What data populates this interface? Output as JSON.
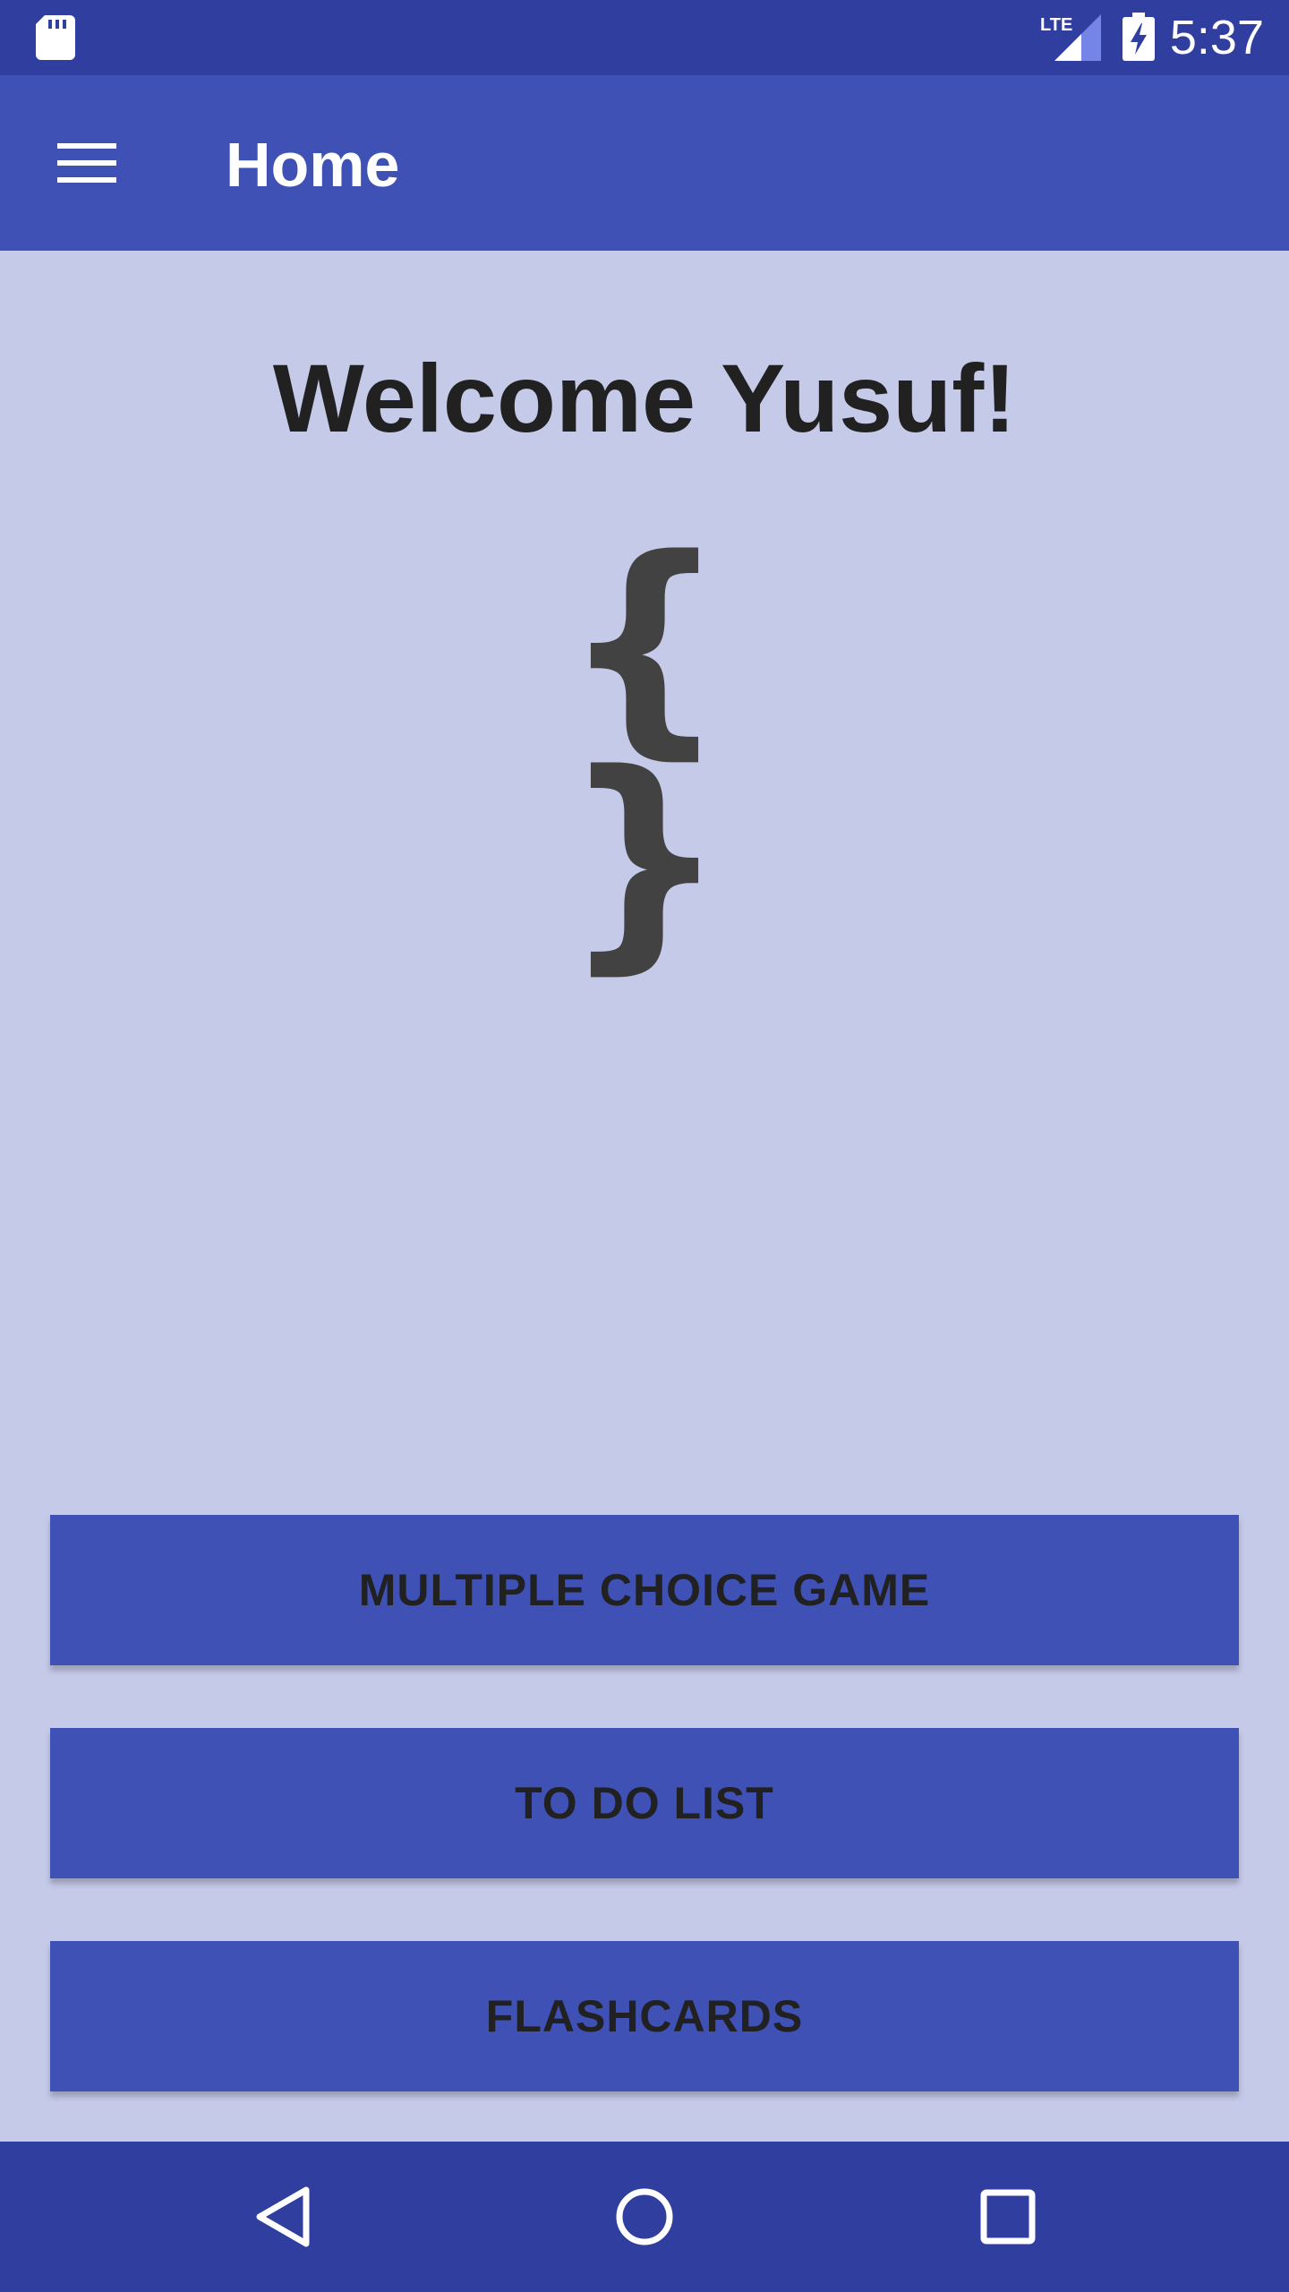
{
  "status_bar": {
    "time": "5:37",
    "network": "LTE",
    "icons": [
      "sd-card-icon",
      "lte-signal-icon",
      "battery-charging-icon"
    ]
  },
  "app_bar": {
    "title": "Home",
    "menu_icon": "hamburger-menu-icon"
  },
  "content": {
    "welcome": "Welcome Yusuf!",
    "logo_text": "{ }"
  },
  "buttons": {
    "multiple_choice": "MULTIPLE CHOICE GAME",
    "todo": "TO DO LIST",
    "flashcards": "FLASHCARDS"
  },
  "nav_bar": {
    "icons": [
      "back-triangle-icon",
      "home-circle-icon",
      "recent-square-icon"
    ]
  },
  "colors": {
    "status_bar": "#303F9F",
    "app_bar": "#3F51B5",
    "background": "#C5CAE9",
    "button": "#3F51B5",
    "text_dark": "#212121"
  }
}
